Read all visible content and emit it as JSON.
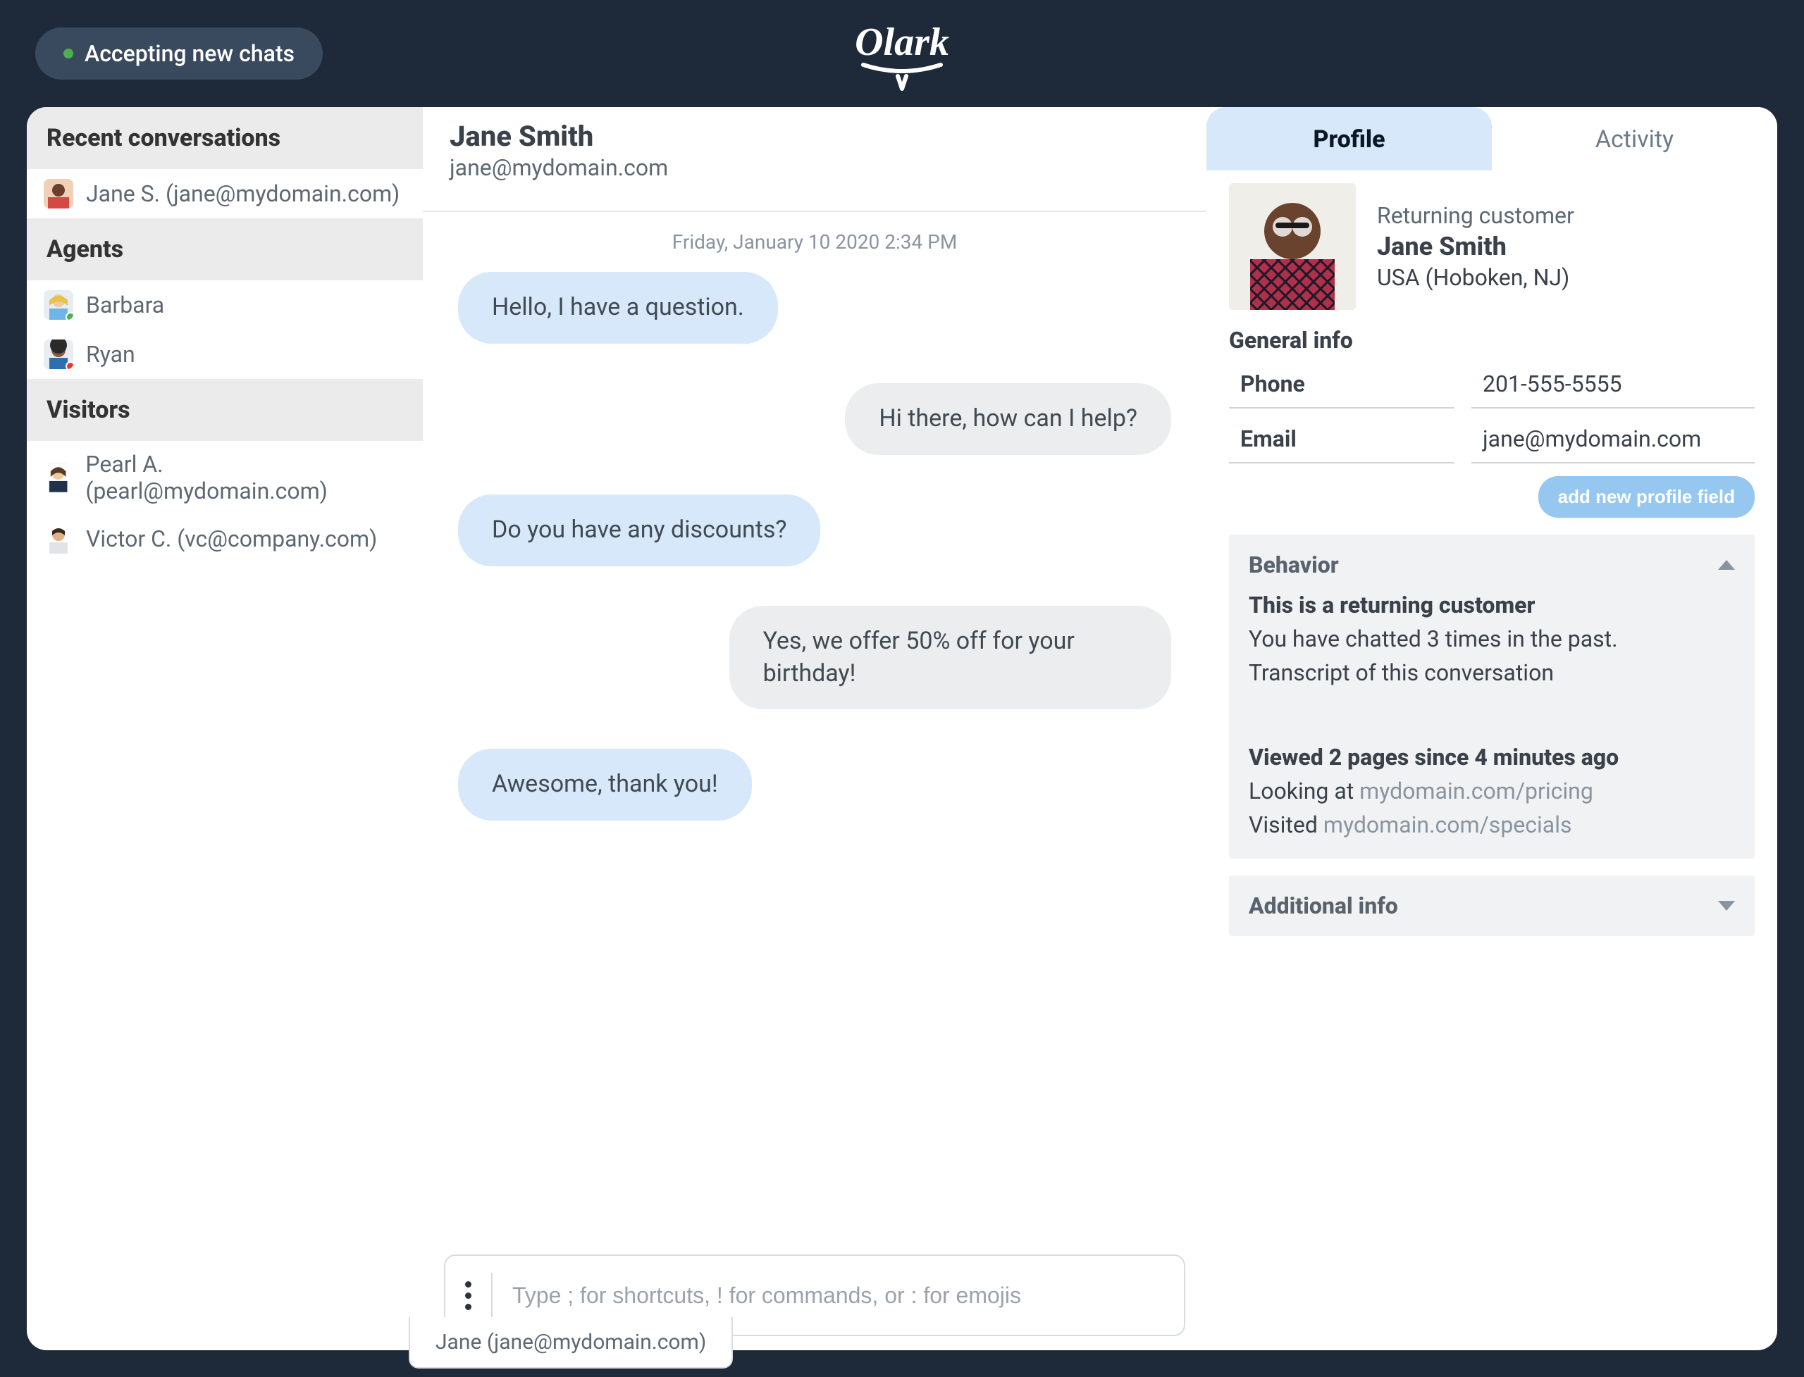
{
  "header": {
    "status_text": "Accepting new chats",
    "brand": "Olark"
  },
  "sidebar": {
    "recent_header": "Recent conversations",
    "recent": [
      {
        "label": "Jane S. (jane@mydomain.com)"
      }
    ],
    "agents_header": "Agents",
    "agents": [
      {
        "label": "Barbara",
        "status": "online"
      },
      {
        "label": "Ryan",
        "status": "away"
      }
    ],
    "visitors_header": "Visitors",
    "visitors": [
      {
        "label": "Pearl A. (pearl@mydomain.com)"
      },
      {
        "label": "Victor C. (vc@company.com)"
      }
    ]
  },
  "chat": {
    "name": "Jane Smith",
    "email": "jane@mydomain.com",
    "date": "Friday, January 10 2020 2:34 PM",
    "messages": [
      {
        "side": "left",
        "text": "Hello, I have a question."
      },
      {
        "side": "right",
        "text": "Hi there, how can I help?"
      },
      {
        "side": "left",
        "text": "Do you have any discounts?"
      },
      {
        "side": "right",
        "text": "Yes, we offer 50% off for your birthday!"
      },
      {
        "side": "left",
        "text": "Awesome, thank you!"
      }
    ],
    "composer_placeholder": "Type ; for shortcuts, ! for commands, or : for emojis",
    "bottom_tab": "Jane (jane@mydomain.com)"
  },
  "tabs": {
    "profile": "Profile",
    "activity": "Activity"
  },
  "profile": {
    "status": "Returning customer",
    "name": "Jane Smith",
    "location": "USA (Hoboken, NJ)",
    "general_info_title": "General info",
    "phone_label": "Phone",
    "phone_value": "201-555-5555",
    "email_label": "Email",
    "email_value": "jane@mydomain.com",
    "add_field_label": "add new profile field",
    "behavior": {
      "title": "Behavior",
      "headline": "This is a returning customer",
      "line1": "You have chatted 3 times in the past.",
      "line2": "Transcript of this conversation",
      "viewed_title": "Viewed 2 pages since 4 minutes ago",
      "looking_prefix": "Looking at ",
      "looking_url": "mydomain.com/pricing",
      "visited_prefix": "Visited ",
      "visited_url": "mydomain.com/specials"
    },
    "additional_info_title": "Additional info"
  }
}
